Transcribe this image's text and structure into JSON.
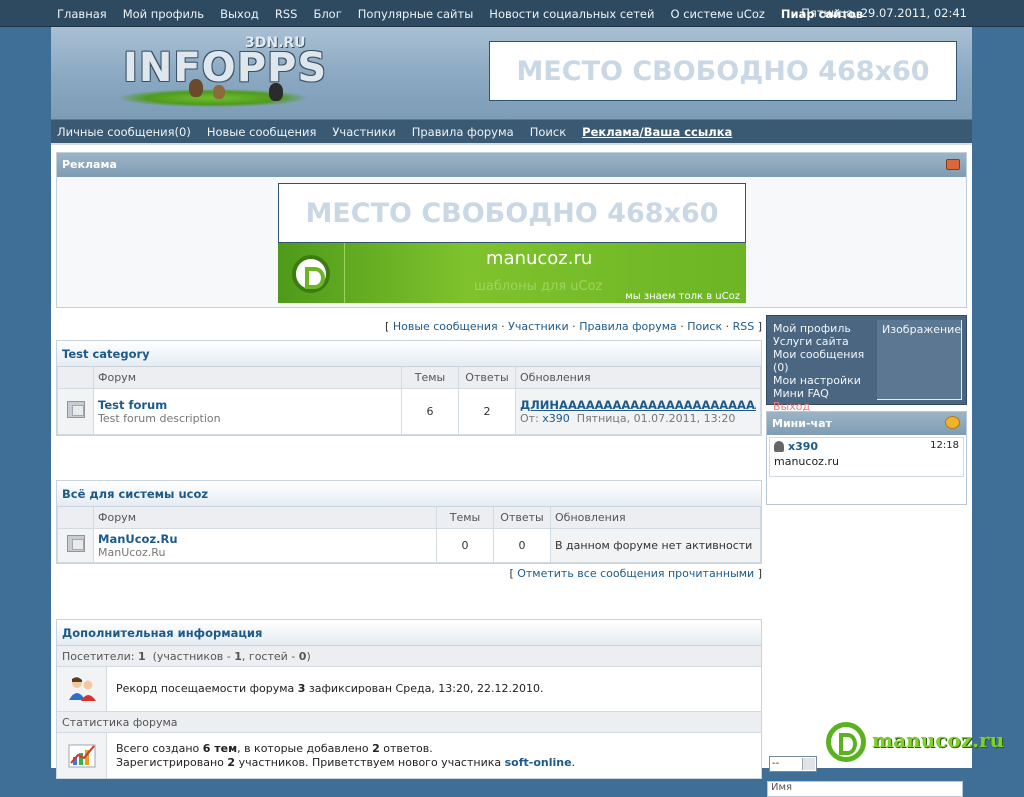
{
  "topnav": {
    "items": [
      "Главная",
      "Мой профиль",
      "Выход",
      "RSS",
      "Блог",
      "Популярные сайты",
      "Новости социальных сетей",
      "О системе uCoz"
    ],
    "bold_item": "Пиар сайтов",
    "datetime": "Пятница, 29.07.2011, 02:41"
  },
  "header": {
    "logo_text": "INFOPPS",
    "logo_sub": "3DN.RU",
    "banner_text": "МЕСТО СВОБОДНО 468x60"
  },
  "subnav": {
    "items": [
      "Личные сообщения(0)",
      "Новые сообщения",
      "Участники",
      "Правила форума",
      "Поиск"
    ],
    "bold_item": "Реклама/Ваша ссылка"
  },
  "ad_block": {
    "title": "Реклама",
    "banner_text": "МЕСТО СВОБОДНО 468x60",
    "manucoz": {
      "title": "manucoz.ru",
      "subtitle": "шаблоны для uCoz",
      "slogan": "мы знаем толк в uCoz"
    }
  },
  "quicklinks": {
    "items": [
      "Новые сообщения",
      "Участники",
      "Правила форума",
      "Поиск",
      "RSS"
    ]
  },
  "columns": {
    "forum": "Форум",
    "topics": "Темы",
    "replies": "Ответы",
    "updates": "Обновления"
  },
  "categories": [
    {
      "title": "Test category",
      "forums": [
        {
          "name": "Test forum",
          "description": "Test forum description",
          "topics": "6",
          "replies": "2",
          "last_post_title": "ДЛИНАААААААААААААААААААААААААА...",
          "last_post_from_label": "От:",
          "last_post_user": "x390",
          "last_post_time": "Пятница, 01.07.2011, 13:20"
        }
      ]
    },
    {
      "title": "Всё для системы ucoz",
      "forums": [
        {
          "name": "ManUcoz.Ru",
          "description": "ManUcoz.Ru",
          "topics": "0",
          "replies": "0",
          "no_activity": "В данном форуме нет активности"
        }
      ]
    }
  ],
  "mark_all_read": "Отметить все сообщения прочитанными",
  "info": {
    "title": "Дополнительная информация",
    "visitors_label": "Посетители:",
    "visitors_count": "1",
    "visitors_members_label": "участников -",
    "visitors_members": "1",
    "visitors_guests_label": "гостей -",
    "visitors_guests": "0",
    "record_prefix": "Рекорд посещаемости форума",
    "record_count": "3",
    "record_suffix": "зафиксирован Среда, 13:20, 22.12.2010.",
    "stats_label": "Статистика форума",
    "stats_line1_a": "Всего создано",
    "stats_topics": "6 тем",
    "stats_line1_b": ", в которые добавлено",
    "stats_replies": "2",
    "stats_line1_c": "ответов.",
    "stats_line2_a": "Зарегистрировано",
    "stats_users": "2",
    "stats_line2_b": "участников. Приветствуем нового участника",
    "stats_newuser": "soft-online",
    "stats_line2_c": "."
  },
  "sidebar": {
    "menu": [
      "Мой профиль",
      "Услуги сайта",
      "Мои сообщения (0)",
      "Мои настройки",
      "Мини FAQ"
    ],
    "logout": "Выход",
    "avatar_label": "Изображение",
    "chat_title": "Мини-чат",
    "chat_messages": [
      {
        "user": "x390",
        "time": "12:18",
        "text": "manucoz.ru"
      }
    ],
    "smiley_select": "--",
    "name_placeholder": "Имя"
  },
  "watermark": {
    "text": "manucoz.ru"
  },
  "colors": {
    "background": "#3f6f97",
    "topbar": "#2e4a60",
    "link": "#1c5a89",
    "logout": "#f47c7c",
    "banner_green": "#7fc22d"
  }
}
